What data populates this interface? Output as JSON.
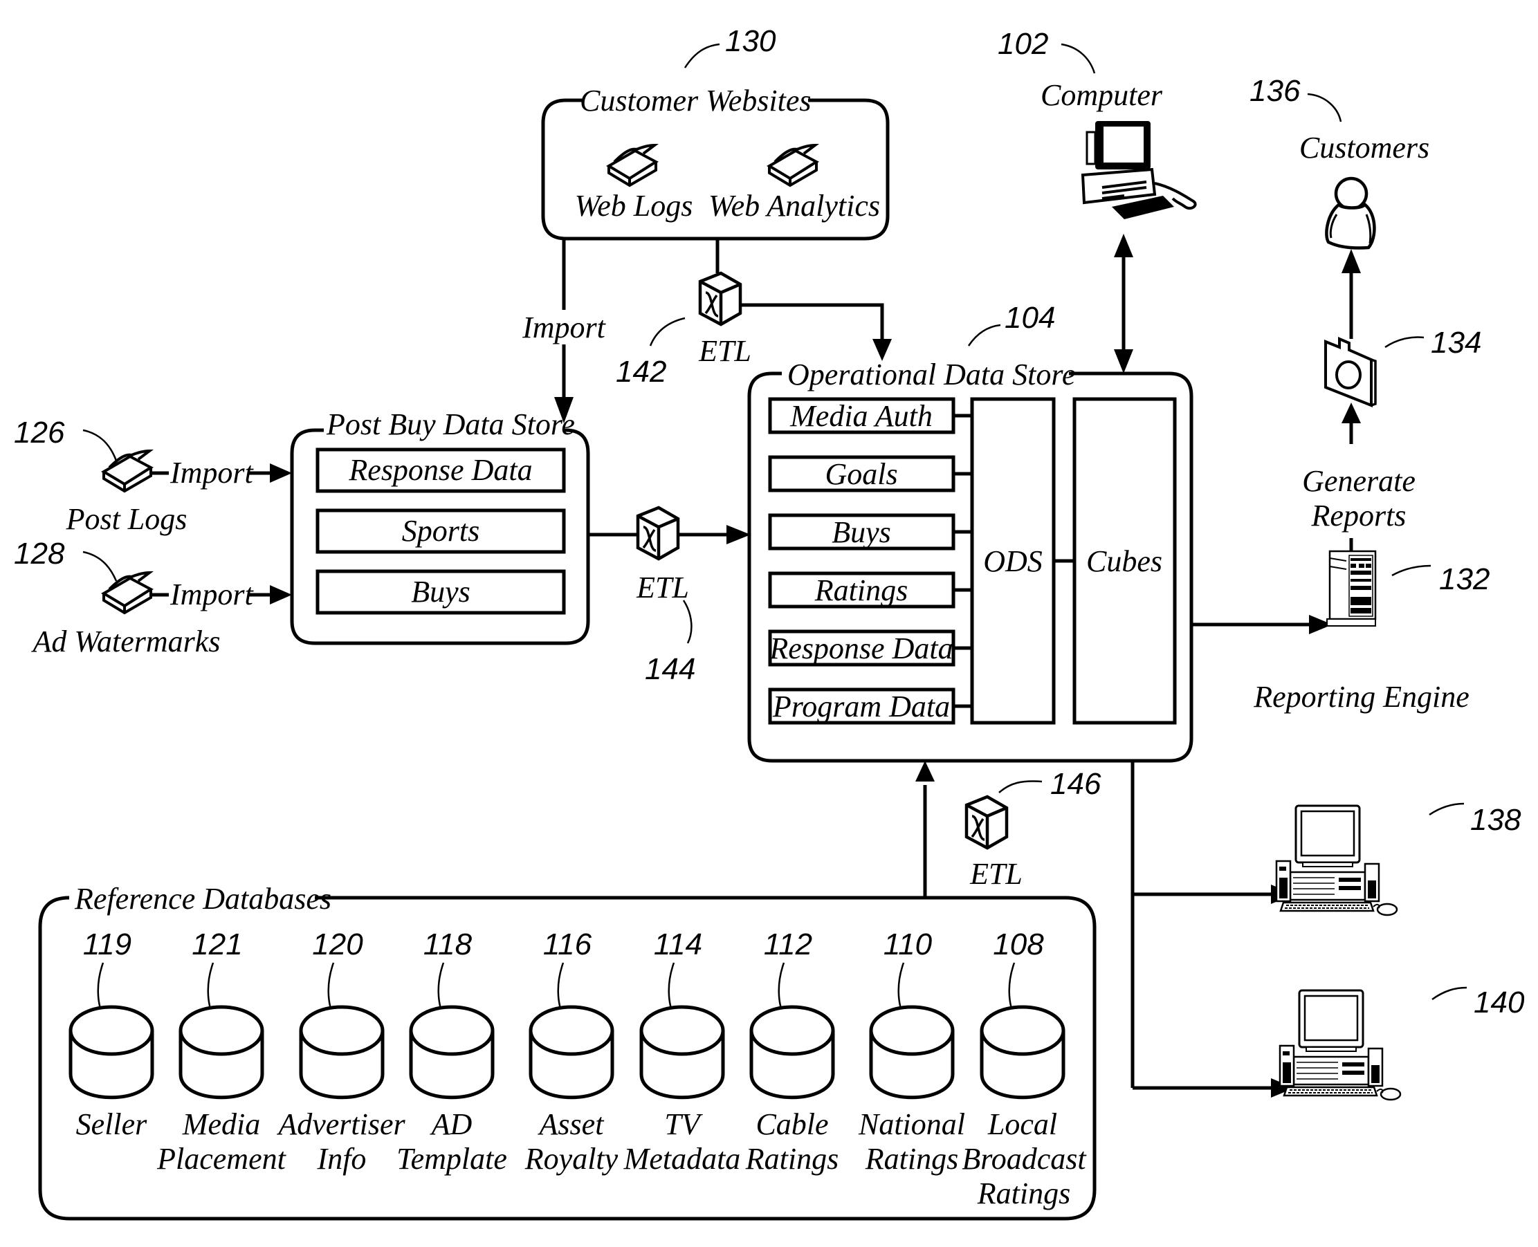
{
  "figure": {
    "customer_websites": {
      "ref": "130",
      "title": "Customer Websites",
      "items": [
        "Web Logs",
        "Web Analytics"
      ]
    },
    "computer": {
      "ref": "102",
      "label": "Computer"
    },
    "customers": {
      "ref": "136",
      "label": "Customers"
    },
    "report": {
      "ref": "134",
      "flow_label_1": "Generate",
      "flow_label_2": "Reports"
    },
    "reporting_engine": {
      "ref": "132",
      "label": "Reporting Engine"
    },
    "etl_142": {
      "ref": "142",
      "label": "ETL"
    },
    "etl_144": {
      "ref": "144",
      "label": "ETL"
    },
    "etl_146": {
      "ref": "146",
      "label": "ETL"
    },
    "import_label": "Import",
    "post_logs": {
      "ref": "126",
      "label": "Post Logs",
      "flow_label": "Import"
    },
    "ad_watermarks": {
      "ref": "128",
      "label": "Ad Watermarks",
      "flow_label": "Import"
    },
    "post_buy_data_store": {
      "title": "Post Buy Data Store",
      "items": [
        "Response Data",
        "Sports",
        "Buys"
      ]
    },
    "operational_data_store": {
      "ref": "104",
      "title": "Operational Data Store",
      "items": [
        "Media Auth",
        "Goals",
        "Buys",
        "Ratings",
        "Response Data",
        "Program Data"
      ],
      "ods_label": "ODS",
      "cubes_label": "Cubes"
    },
    "client_138": {
      "ref": "138"
    },
    "client_140": {
      "ref": "140"
    },
    "reference_databases": {
      "title": "Reference Databases",
      "items": [
        {
          "ref": "119",
          "line1": "Seller",
          "line2": "",
          "line3": ""
        },
        {
          "ref": "121",
          "line1": "Media",
          "line2": "Placement",
          "line3": ""
        },
        {
          "ref": "120",
          "line1": "Advertiser",
          "line2": "Info",
          "line3": ""
        },
        {
          "ref": "118",
          "line1": "AD",
          "line2": "Template",
          "line3": ""
        },
        {
          "ref": "116",
          "line1": "Asset",
          "line2": "Royalty",
          "line3": ""
        },
        {
          "ref": "114",
          "line1": "TV",
          "line2": "Metadata",
          "line3": ""
        },
        {
          "ref": "112",
          "line1": "Cable",
          "line2": "Ratings",
          "line3": ""
        },
        {
          "ref": "110",
          "line1": "National",
          "line2": "Ratings",
          "line3": ""
        },
        {
          "ref": "108",
          "line1": "Local",
          "line2": "Broadcast",
          "line3": "Ratings"
        }
      ]
    }
  }
}
